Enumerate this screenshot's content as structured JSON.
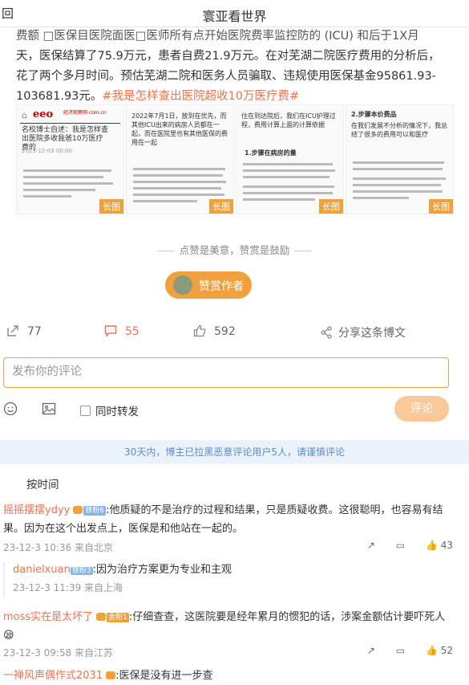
{
  "topbar": {
    "back": "回",
    "title": "寰亚看世界"
  },
  "article": {
    "line1": "费额 □医保目医院面医□医师所有点开始医院费率监控防的 (ICU) 和后于1X月",
    "line2": "天，医保结算了75.9万元，患者自费21.9万元。在对芜湖二院医疗费用的分析后，",
    "line3": "花了两个多月时间。预估芜湖二院和医务人员骗取、违规使用医保基金95861.93-",
    "line4_value": "103681.93元。",
    "hashtag": "#我是怎样查出医院超收10万医疗费#"
  },
  "thumbnails": [
    {
      "brand": "eeo",
      "subtitle": "经济观察网 com.cn",
      "headline": "名校博士自述：我是怎样查出医院多收我爸10万医疗费的",
      "date": "2023-12-03 00:00",
      "tag": "长图"
    },
    {
      "text": "2022年7月1日，放到在优先，而其他ICU出来的病房人员都在一起，而在医院里也有其他医保的费用在一起",
      "tag": "长图"
    },
    {
      "heading": "1.步骤在病房的量",
      "text": "住在到达院后，我们在ICU护理过程，费用计算上面的计算依据",
      "tag": "长图"
    },
    {
      "heading": "2.步骤本价费品",
      "text": "在我们发展不分析的情况下，我总结了很多的费用可以和医疗",
      "tag": "长图"
    }
  ],
  "tip": "点赞是美意，赞赏是鼓励",
  "reward_label": "赞赏作者",
  "actions": {
    "repost_count": "77",
    "comment_count": "55",
    "like_count": "592",
    "share_label": "分享这条博文"
  },
  "comment_input": {
    "placeholder": "发布你的评论"
  },
  "tools": {
    "repost_checkbox": "同时转发",
    "submit": "评论"
  },
  "notice": "30天内，博主已拉黑恶意评论用户5人，请谨慎评论",
  "sort_label": "按时间",
  "comments": [
    {
      "user": "摇摇摆摆ydyy",
      "badge": "铁粉6",
      "text": ":他质疑的不是治疗的过程和结果，只是质疑收费。这很聪明，也容易有结果。因为在这个出发点上，医保是和他站在一起的。",
      "meta": "23-12-3 10:36 来自北京",
      "likes": "43",
      "reply": {
        "user": "danielxuan",
        "badge": "铁粉3",
        "text": ":因为治疗方案更为专业和主观",
        "meta": "23-12-3 11:39 来自上海"
      }
    },
    {
      "user": "moss实在是太坏了",
      "badge": "金粉1",
      "text": ":仔细查查，这医院要是经年累月的惯犯的话，涉案金额估计要吓死人",
      "emoji": "😪",
      "meta": "23-12-3 09:58 来自江苏",
      "likes": "52"
    },
    {
      "user": "一禅风声偶作式2031",
      "text": ":医保是没有进一步查"
    }
  ],
  "colors": {
    "accent": "#eb7350",
    "reward": "#f0a13c",
    "notice_bg": "#eaf2fb",
    "notice_text": "#5a8ec4"
  }
}
